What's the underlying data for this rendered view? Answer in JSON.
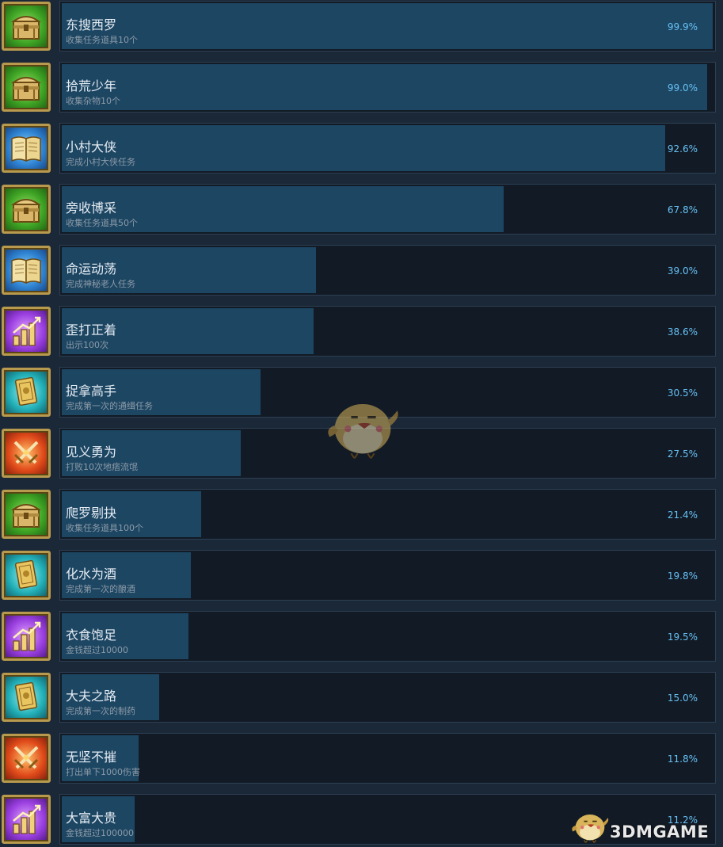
{
  "achievements": [
    {
      "title": "东搜西罗",
      "desc": "收集任务道具10个",
      "percent": "99.9%",
      "fill": 0.999,
      "icon": "treasure-chest-icon",
      "color": "green"
    },
    {
      "title": "拾荒少年",
      "desc": "收集杂物10个",
      "percent": "99.0%",
      "fill": 0.99,
      "icon": "treasure-chest-icon",
      "color": "green"
    },
    {
      "title": "小村大侠",
      "desc": "完成小村大侠任务",
      "percent": "92.6%",
      "fill": 0.926,
      "icon": "open-book-icon",
      "color": "blue"
    },
    {
      "title": "旁收博采",
      "desc": "收集任务道具50个",
      "percent": "67.8%",
      "fill": 0.678,
      "icon": "treasure-chest-icon",
      "color": "green"
    },
    {
      "title": "命运动荡",
      "desc": "完成神秘老人任务",
      "percent": "39.0%",
      "fill": 0.39,
      "icon": "open-book-icon",
      "color": "blue"
    },
    {
      "title": "歪打正着",
      "desc": "出示100次",
      "percent": "38.6%",
      "fill": 0.386,
      "icon": "growth-bars-icon",
      "color": "purple"
    },
    {
      "title": "捉拿高手",
      "desc": "完成第一次的通缉任务",
      "percent": "30.5%",
      "fill": 0.305,
      "icon": "golden-card-icon",
      "color": "teal"
    },
    {
      "title": "见义勇为",
      "desc": "打败10次地痞流氓",
      "percent": "27.5%",
      "fill": 0.275,
      "icon": "crossed-swords-icon",
      "color": "red"
    },
    {
      "title": "爬罗剔抉",
      "desc": "收集任务道具100个",
      "percent": "21.4%",
      "fill": 0.214,
      "icon": "treasure-chest-icon",
      "color": "green"
    },
    {
      "title": "化水为酒",
      "desc": "完成第一次的酿酒",
      "percent": "19.8%",
      "fill": 0.198,
      "icon": "golden-card-icon",
      "color": "teal"
    },
    {
      "title": "衣食饱足",
      "desc": "金钱超过10000",
      "percent": "19.5%",
      "fill": 0.195,
      "icon": "growth-bars-icon",
      "color": "purple"
    },
    {
      "title": "大夫之路",
      "desc": "完成第一次的制药",
      "percent": "15.0%",
      "fill": 0.15,
      "icon": "golden-card-icon",
      "color": "teal"
    },
    {
      "title": "无坚不摧",
      "desc": "打出单下1000伤害",
      "percent": "11.8%",
      "fill": 0.118,
      "icon": "crossed-swords-icon",
      "color": "red"
    },
    {
      "title": "大富大贵",
      "desc": "金钱超过100000",
      "percent": "11.2%",
      "fill": 0.112,
      "icon": "growth-bars-icon",
      "color": "purple"
    }
  ],
  "watermark": {
    "text": "3DMGAME",
    "icon": "bird-mascot-icon"
  },
  "center_mascot": {
    "icon": "bird-mascot-icon"
  },
  "colors": {
    "bar": "#1d4663",
    "percent": "#66c0f4",
    "background": "#1b2838"
  }
}
